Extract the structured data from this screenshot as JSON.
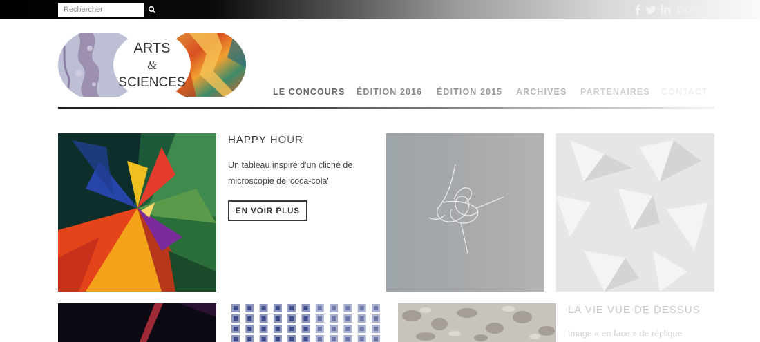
{
  "topbar": {
    "search_placeholder": "Rechercher",
    "search_icon": "magnifier-icon",
    "social": [
      "facebook-icon",
      "twitter-icon",
      "linkedin-icon"
    ],
    "docup_label": "DOC'UP"
  },
  "logo": {
    "line1": "ARTS",
    "line2": "&",
    "line3": "SCIENCES"
  },
  "nav": {
    "items": [
      {
        "label": "LE CONCOURS",
        "color": "#666666"
      },
      {
        "label": "ÉDITION 2016",
        "color": "#888888"
      },
      {
        "label": "ÉDITION 2015",
        "color": "#9a9a9a"
      },
      {
        "label": "ARCHIVES",
        "color": "#b5b5b5"
      },
      {
        "label": "PARTENAIRES",
        "color": "#d0d0d0"
      },
      {
        "label": "CONTACT",
        "color": "#eeeeee"
      }
    ]
  },
  "feature": {
    "title_first": "HAPPY",
    "title_second": "HOUR",
    "description": "Un tableau inspiré d'un cliché de microscopie de 'coca-cola'",
    "button_label": "EN VOIR PLUS"
  },
  "row2": {
    "title": "LA VIE VUE DE DESSUS",
    "description": "Image « en face » de réplique"
  }
}
